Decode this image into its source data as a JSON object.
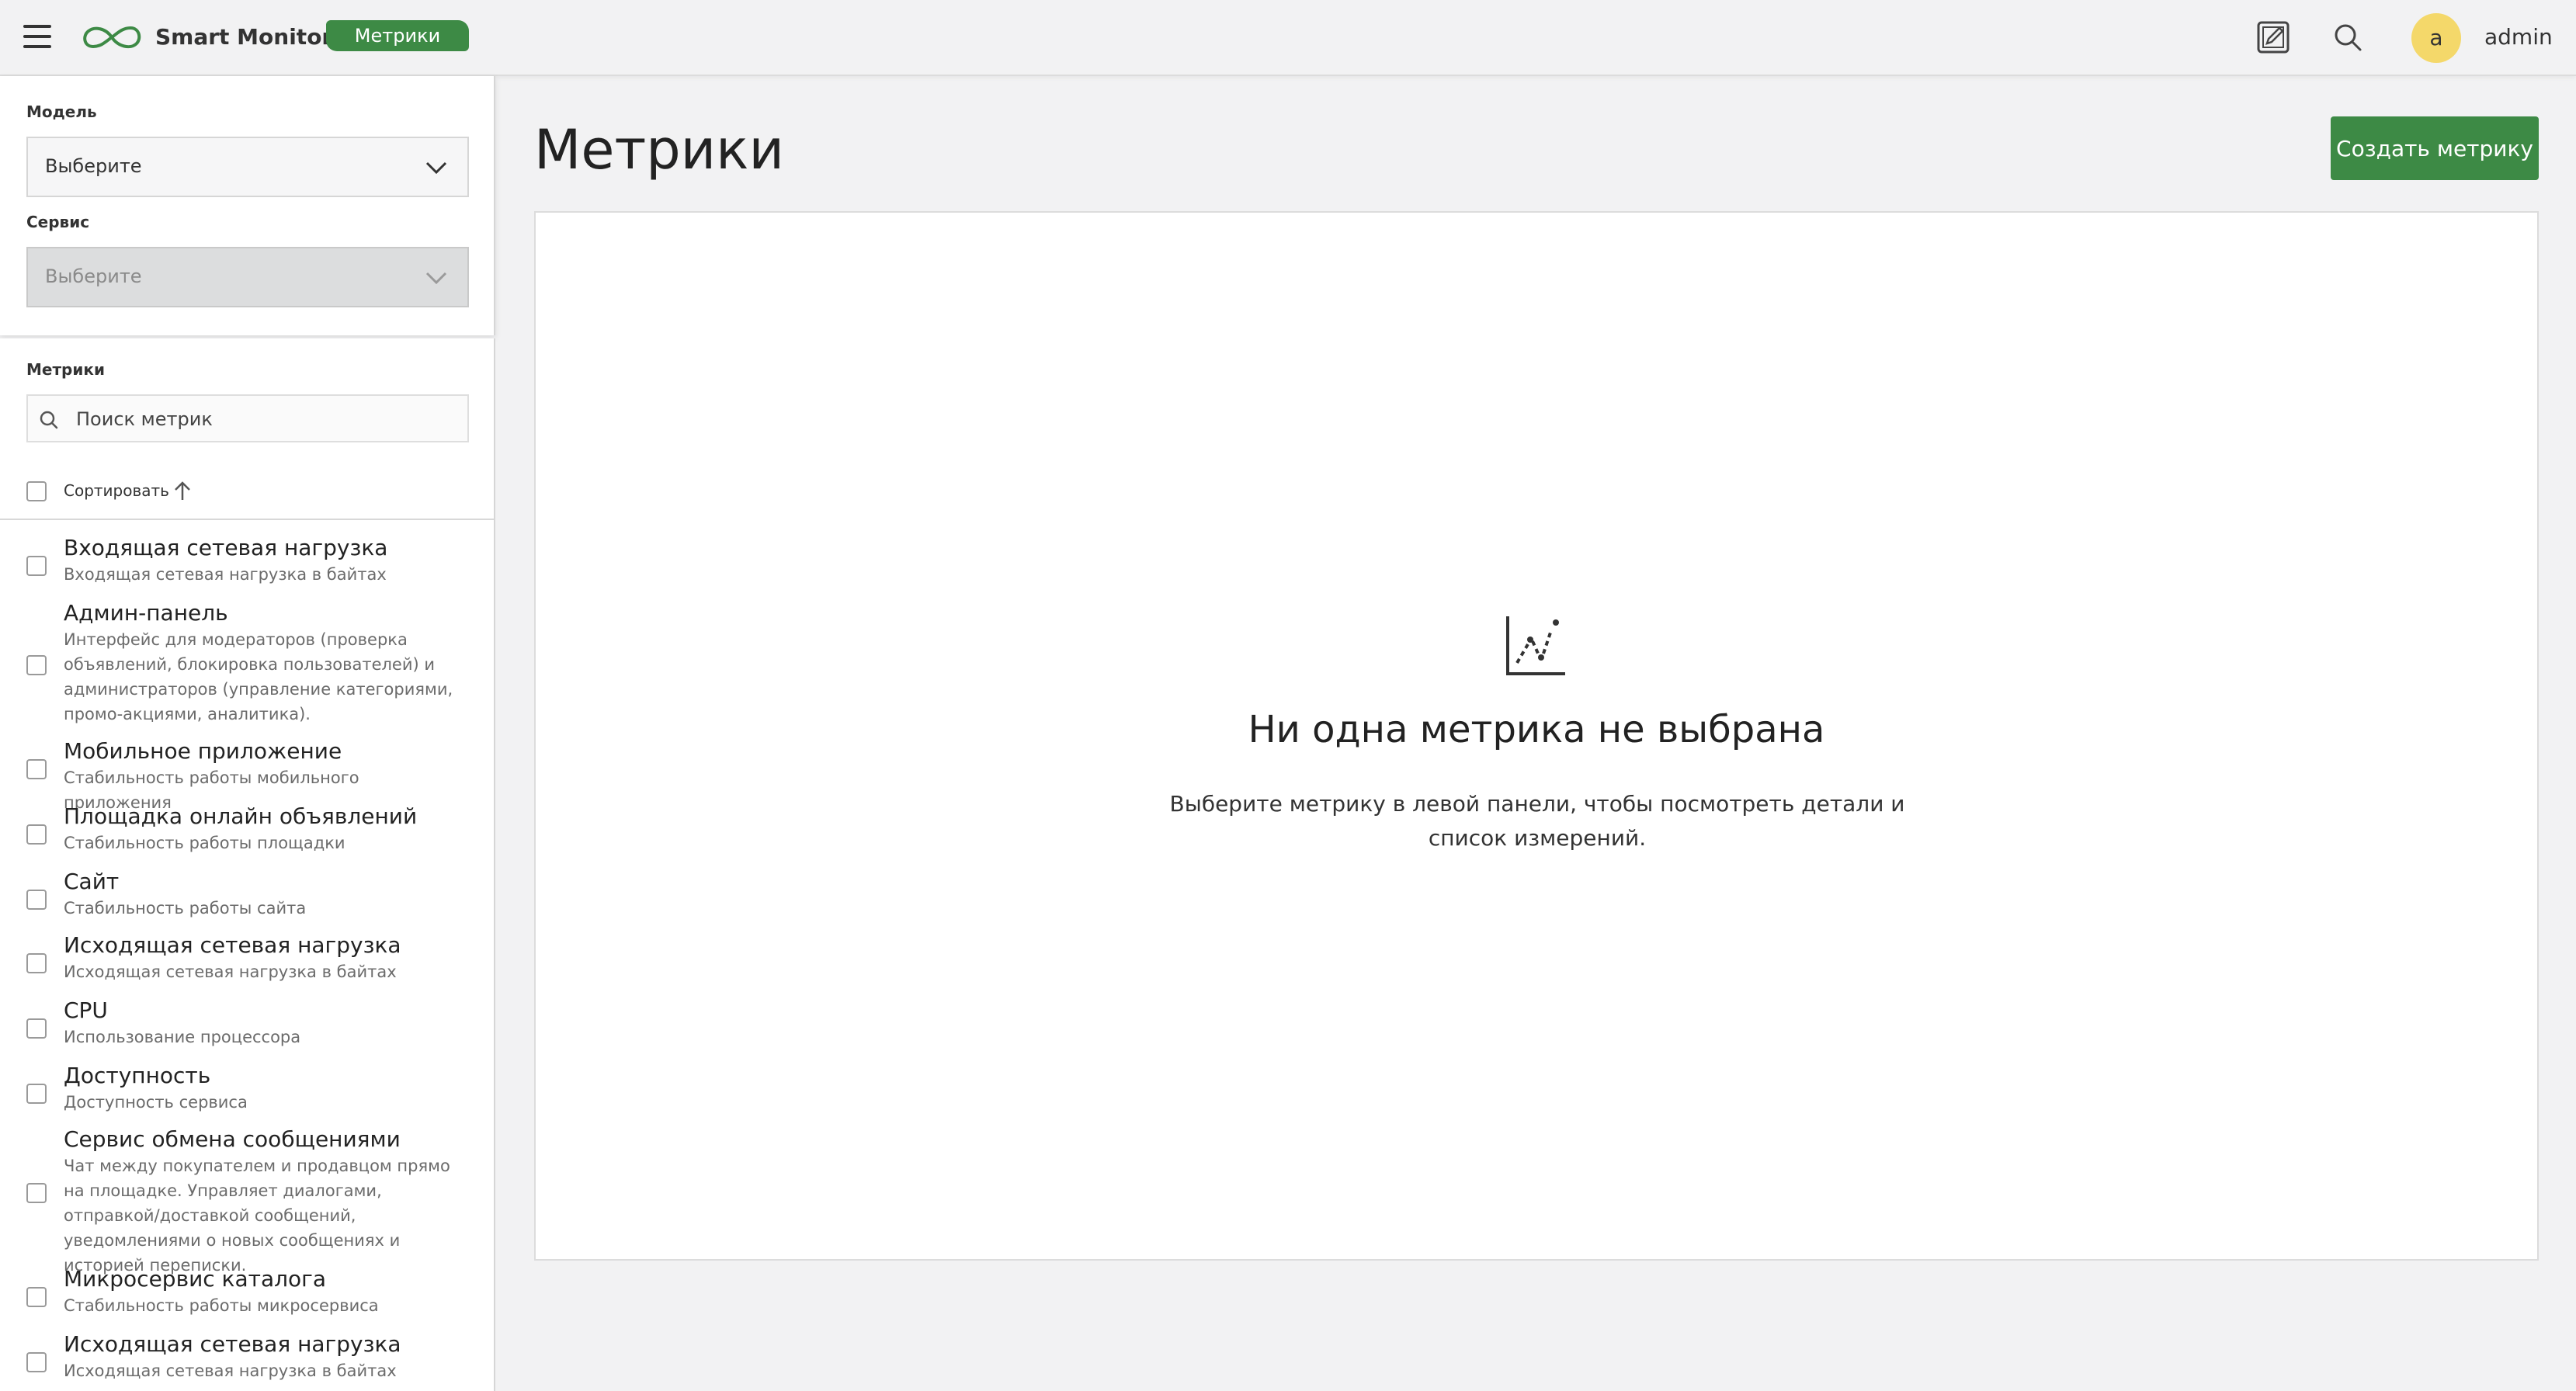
{
  "header": {
    "brand": "Smart Monitor",
    "section_badge": "Метрики",
    "user_initial": "a",
    "username": "admin"
  },
  "filters": {
    "model_label": "Модель",
    "model_value": "Выберите",
    "service_label": "Сервис",
    "service_value": "Выберите"
  },
  "metrics_panel": {
    "label": "Метрики",
    "search_placeholder": "Поиск метрик",
    "sort_label": "Сортировать",
    "items": [
      {
        "title": "Входящая сетевая нагрузка",
        "desc": "Входящая сетевая нагрузка в байтах"
      },
      {
        "title": "Админ-панель",
        "desc": "Интерфейс для модераторов (проверка объявлений, блокировка пользователей) и администраторов (управление категориями, промо-акциями, аналитика)."
      },
      {
        "title": "Мобильное приложение",
        "desc": "Стабильность работы мобильного приложения"
      },
      {
        "title": "Площадка онлайн объявлений",
        "desc": "Стабильность работы площадки"
      },
      {
        "title": "Сайт",
        "desc": "Стабильность работы сайта"
      },
      {
        "title": "Исходящая сетевая нагрузка",
        "desc": "Исходящая сетевая нагрузка в байтах"
      },
      {
        "title": "CPU",
        "desc": "Использование процессора"
      },
      {
        "title": "Доступность",
        "desc": "Доступность сервиса"
      },
      {
        "title": "Сервис обмена сообщениями",
        "desc": "Чат между покупателем и продавцом прямо на площадке. Управляет диалогами, отправкой/доставкой сообщений, уведомлениями о новых сообщениях и историей переписки."
      },
      {
        "title": "Микросервис каталога",
        "desc": "Стабильность работы микросервиса"
      },
      {
        "title": "Исходящая сетевая нагрузка",
        "desc": "Исходящая сетевая нагрузка в байтах"
      }
    ]
  },
  "main": {
    "title": "Метрики",
    "create_button": "Создать метрику",
    "empty_title": "Ни одна метрика не выбрана",
    "empty_text": "Выберите метрику в левой панели, чтобы посмотреть детали и список измерений."
  },
  "colors": {
    "accent": "#3d8a45",
    "avatar": "#f4d86a"
  }
}
